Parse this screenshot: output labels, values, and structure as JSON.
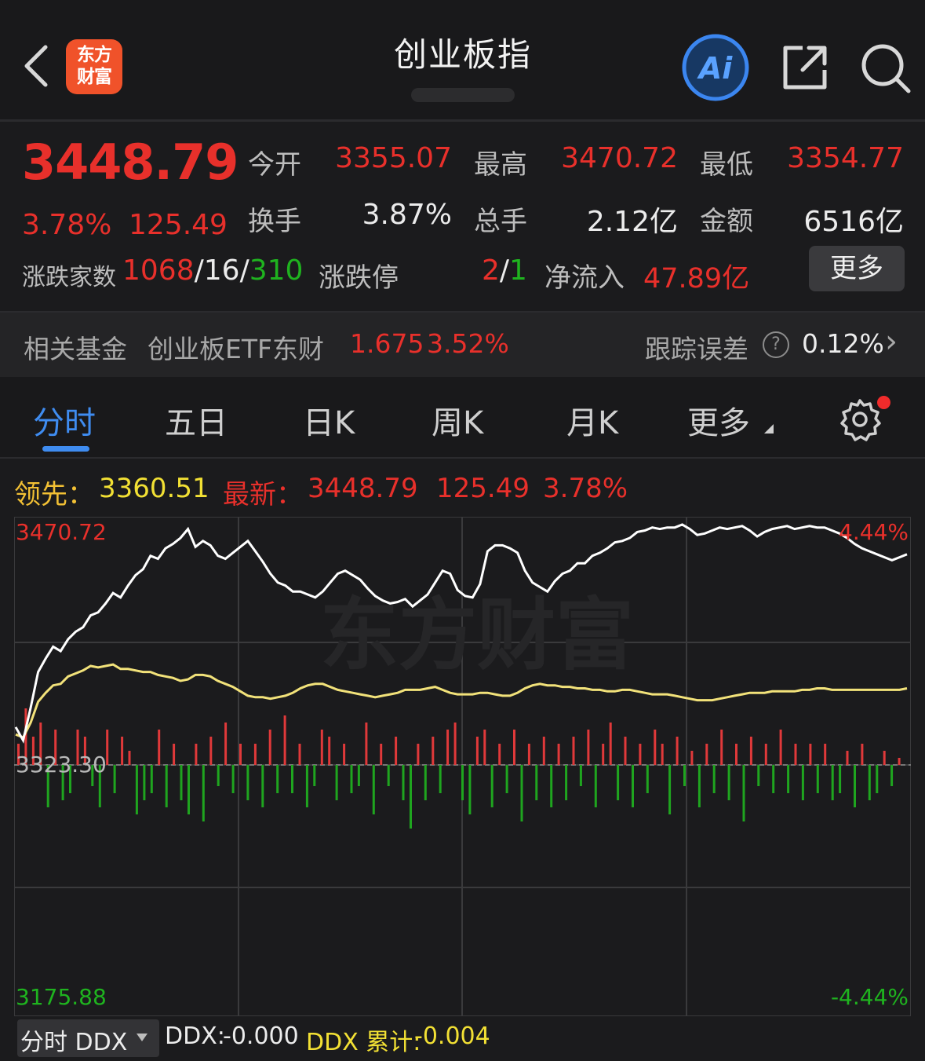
{
  "header": {
    "title": "创业板指",
    "logo_text": "东方财富",
    "ai_label": "Ai"
  },
  "quote": {
    "price": "3448.79",
    "change_pct": "3.78%",
    "change": "125.49",
    "open_label": "今开",
    "open": "3355.07",
    "high_label": "最高",
    "high": "3470.72",
    "low_label": "最低",
    "low": "3354.77",
    "turnover_label": "换手",
    "turnover": "3.87%",
    "volume_label": "总手",
    "volume": "2.12亿",
    "amount_label": "金额",
    "amount": "6516亿",
    "breadth_label": "涨跌家数",
    "breadth_up": "1068",
    "breadth_flat": "16",
    "breadth_down": "310",
    "sep": "/",
    "limit_label": "涨跌停",
    "limit_up": "2",
    "limit_down": "1",
    "netflow_label": "净流入",
    "netflow": "47.89亿",
    "more_button": "更多"
  },
  "fund": {
    "label": "相关基金",
    "name": "创业板ETF东财",
    "price": "1.675",
    "change_pct": "3.52%",
    "tracking_label": "跟踪误差",
    "tracking_value": "0.12%",
    "help_glyph": "?",
    "arrow_glyph": "›"
  },
  "tabs": [
    "分时",
    "五日",
    "日K",
    "周K",
    "月K",
    "更多"
  ],
  "info_line": {
    "lead_label": "领先：",
    "lead_value": "3360.51",
    "latest_label": "最新：",
    "latest_value": "3448.79",
    "change": "125.49",
    "change_pct": "3.78%"
  },
  "chart_data": {
    "type": "line",
    "y_max_label": "3470.72",
    "y_mid_label": "3323.30",
    "y_min_label": "3175.88",
    "pct_max_label": "4.44%",
    "pct_min_label": "-4.44%",
    "ylim": [
      3175.88,
      3470.72
    ],
    "watermark": "东方财富",
    "colors": {
      "price": "#ffffff",
      "lead": "#f2e034",
      "up_bar": "#e0393a",
      "down_bar": "#1fa51f",
      "grid": "#3a3a3c"
    },
    "series": [
      {
        "values": [
          3335,
          3326,
          3348,
          3372,
          3381,
          3389,
          3386,
          3394,
          3399,
          3402,
          3410,
          3412,
          3418,
          3425,
          3422,
          3430,
          3437,
          3441,
          3450,
          3448,
          3455,
          3458,
          3462,
          3468,
          3456,
          3460,
          3457,
          3450,
          3448,
          3452,
          3456,
          3460,
          3453,
          3446,
          3438,
          3432,
          3430,
          3426,
          3426,
          3424,
          3422,
          3426,
          3432,
          3438,
          3440,
          3437,
          3434,
          3428,
          3423,
          3420,
          3418,
          3419,
          3421,
          3416,
          3420,
          3424,
          3432,
          3440,
          3438,
          3427,
          3423,
          3422,
          3431,
          3453,
          3457,
          3457,
          3455,
          3452,
          3440,
          3432,
          3429,
          3426,
          3433,
          3438,
          3440,
          3445,
          3445,
          3450,
          3452,
          3455,
          3459,
          3460,
          3462,
          3466,
          3467,
          3469,
          3468,
          3469,
          3469,
          3471,
          3468,
          3464,
          3465,
          3467,
          3469,
          3468,
          3469,
          3470,
          3467,
          3463,
          3466,
          3468,
          3469,
          3470,
          3468,
          3469,
          3470,
          3469,
          3469,
          3467,
          3465,
          3462,
          3458,
          3455,
          3453,
          3451,
          3449,
          3447,
          3449,
          3451
        ]
      },
      {
        "values": [
          3330,
          3328,
          3338,
          3352,
          3358,
          3363,
          3364,
          3369,
          3371,
          3373,
          3376,
          3375,
          3376,
          3377,
          3374,
          3374,
          3373,
          3372,
          3372,
          3370,
          3369,
          3368,
          3366,
          3367,
          3370,
          3370,
          3369,
          3366,
          3364,
          3362,
          3359,
          3356,
          3355,
          3355,
          3354,
          3355,
          3356,
          3358,
          3361,
          3363,
          3364,
          3364,
          3362,
          3360,
          3359,
          3358,
          3357,
          3356,
          3355,
          3356,
          3357,
          3358,
          3360,
          3360,
          3360,
          3361,
          3362,
          3360,
          3358,
          3357,
          3357,
          3357,
          3358,
          3358,
          3357,
          3356,
          3356,
          3358,
          3361,
          3363,
          3364,
          3363,
          3363,
          3362,
          3362,
          3361,
          3361,
          3360,
          3360,
          3359,
          3359,
          3360,
          3360,
          3359,
          3358,
          3357,
          3357,
          3357,
          3356,
          3355,
          3354,
          3353,
          3353,
          3353,
          3354,
          3355,
          3356,
          3357,
          3358,
          3358,
          3358,
          3359,
          3359,
          3359,
          3359,
          3360,
          3360,
          3361,
          3361,
          3360,
          3360,
          3360,
          3360,
          3360,
          3360,
          3360,
          3360,
          3360,
          3360,
          3361
        ]
      }
    ],
    "bars": [
      0.3,
      0.8,
      0.4,
      0.6,
      -0.6,
      0.5,
      -0.5,
      -0.4,
      0.5,
      0.4,
      -0.3,
      -0.6,
      0.5,
      -0.4,
      0.4,
      0.2,
      -0.7,
      -0.5,
      -0.4,
      0.5,
      -0.6,
      0.3,
      -0.5,
      -0.7,
      0.3,
      -0.8,
      0.4,
      -0.3,
      0.6,
      -0.4,
      0.3,
      -0.5,
      0.3,
      -0.6,
      0.5,
      -0.4,
      0.7,
      -0.4,
      0.3,
      -0.6,
      -0.3,
      0.5,
      0.4,
      -0.5,
      0.3,
      -0.4,
      -0.3,
      0.6,
      -0.7,
      0.3,
      -0.3,
      0.4,
      -0.5,
      -0.9,
      0.3,
      -0.5,
      0.4,
      -0.4,
      0.5,
      0.6,
      -0.5,
      -0.7,
      0.4,
      0.5,
      -0.6,
      0.3,
      -0.4,
      0.5,
      -0.8,
      0.3,
      -0.5,
      0.4,
      -0.6,
      0.3,
      -0.5,
      0.4,
      -0.3,
      0.5,
      -0.6,
      0.3,
      0.6,
      -0.5,
      0.4,
      -0.6,
      0.3,
      -0.4,
      0.5,
      0.3,
      -0.7,
      0.4,
      -0.3,
      0.2,
      -0.6,
      0.3,
      -0.4,
      0.5,
      -0.5,
      0.3,
      -0.8,
      0.4,
      -0.3,
      0.3,
      -0.4,
      0.5,
      -0.4,
      0.3,
      -0.5,
      0.3,
      -0.4,
      0.3,
      -0.5,
      -0.4,
      0.2,
      -0.6,
      0.3,
      -0.5,
      -0.4,
      0.2,
      -0.3,
      0.1
    ],
    "footer": {
      "select_label": "分时 DDX",
      "ddx_label": "DDX:",
      "ddx_value": "-0.000",
      "ddx_cum_label": "DDX 累计:",
      "ddx_cum_value": "-0.004"
    }
  }
}
